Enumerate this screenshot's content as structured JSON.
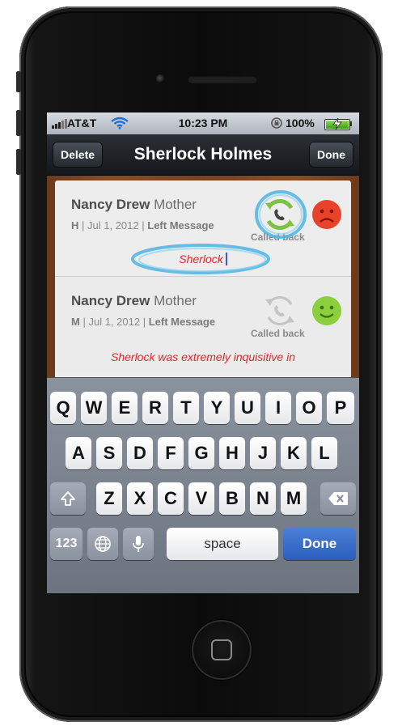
{
  "status_bar": {
    "carrier": "AT&T",
    "time": "10:23 PM",
    "battery": "100%",
    "icons": [
      "signal-bars-icon",
      "wifi-icon",
      "rotation-lock-icon",
      "battery-charging-icon"
    ]
  },
  "nav": {
    "title": "Sherlock Holmes",
    "left_button": "Delete",
    "right_button": "Done"
  },
  "entries": [
    {
      "name": "Nancy Drew",
      "relation": "Mother",
      "type_code": "H",
      "date": "Jul 1, 2012",
      "status": "Left Message",
      "callback_label": "Called back",
      "callback_state": "active",
      "mood": "sad",
      "note": "Sherlock"
    },
    {
      "name": "Nancy Drew",
      "relation": "Mother",
      "type_code": "M",
      "date": "Jul 1, 2012",
      "status": "Left Message",
      "callback_label": "Called back",
      "callback_state": "inactive",
      "mood": "happy",
      "note": "Sherlock was extremely inquisitive in"
    }
  ],
  "keyboard": {
    "row1": [
      "Q",
      "W",
      "E",
      "R",
      "T",
      "Y",
      "U",
      "I",
      "O",
      "P"
    ],
    "row2": [
      "A",
      "S",
      "D",
      "F",
      "G",
      "H",
      "J",
      "K",
      "L"
    ],
    "row3": [
      "Z",
      "X",
      "C",
      "V",
      "B",
      "N",
      "M"
    ],
    "numbers_key": "123",
    "space_key": "space",
    "done_key": "Done"
  },
  "colors": {
    "note_text": "#e0262a",
    "callback_active": "#7cc243",
    "sad_face": "#e8432a",
    "happy_face": "#8ccf3c",
    "done_key": "#2b5fbe",
    "highlight_ring": "#4fb3e3"
  }
}
